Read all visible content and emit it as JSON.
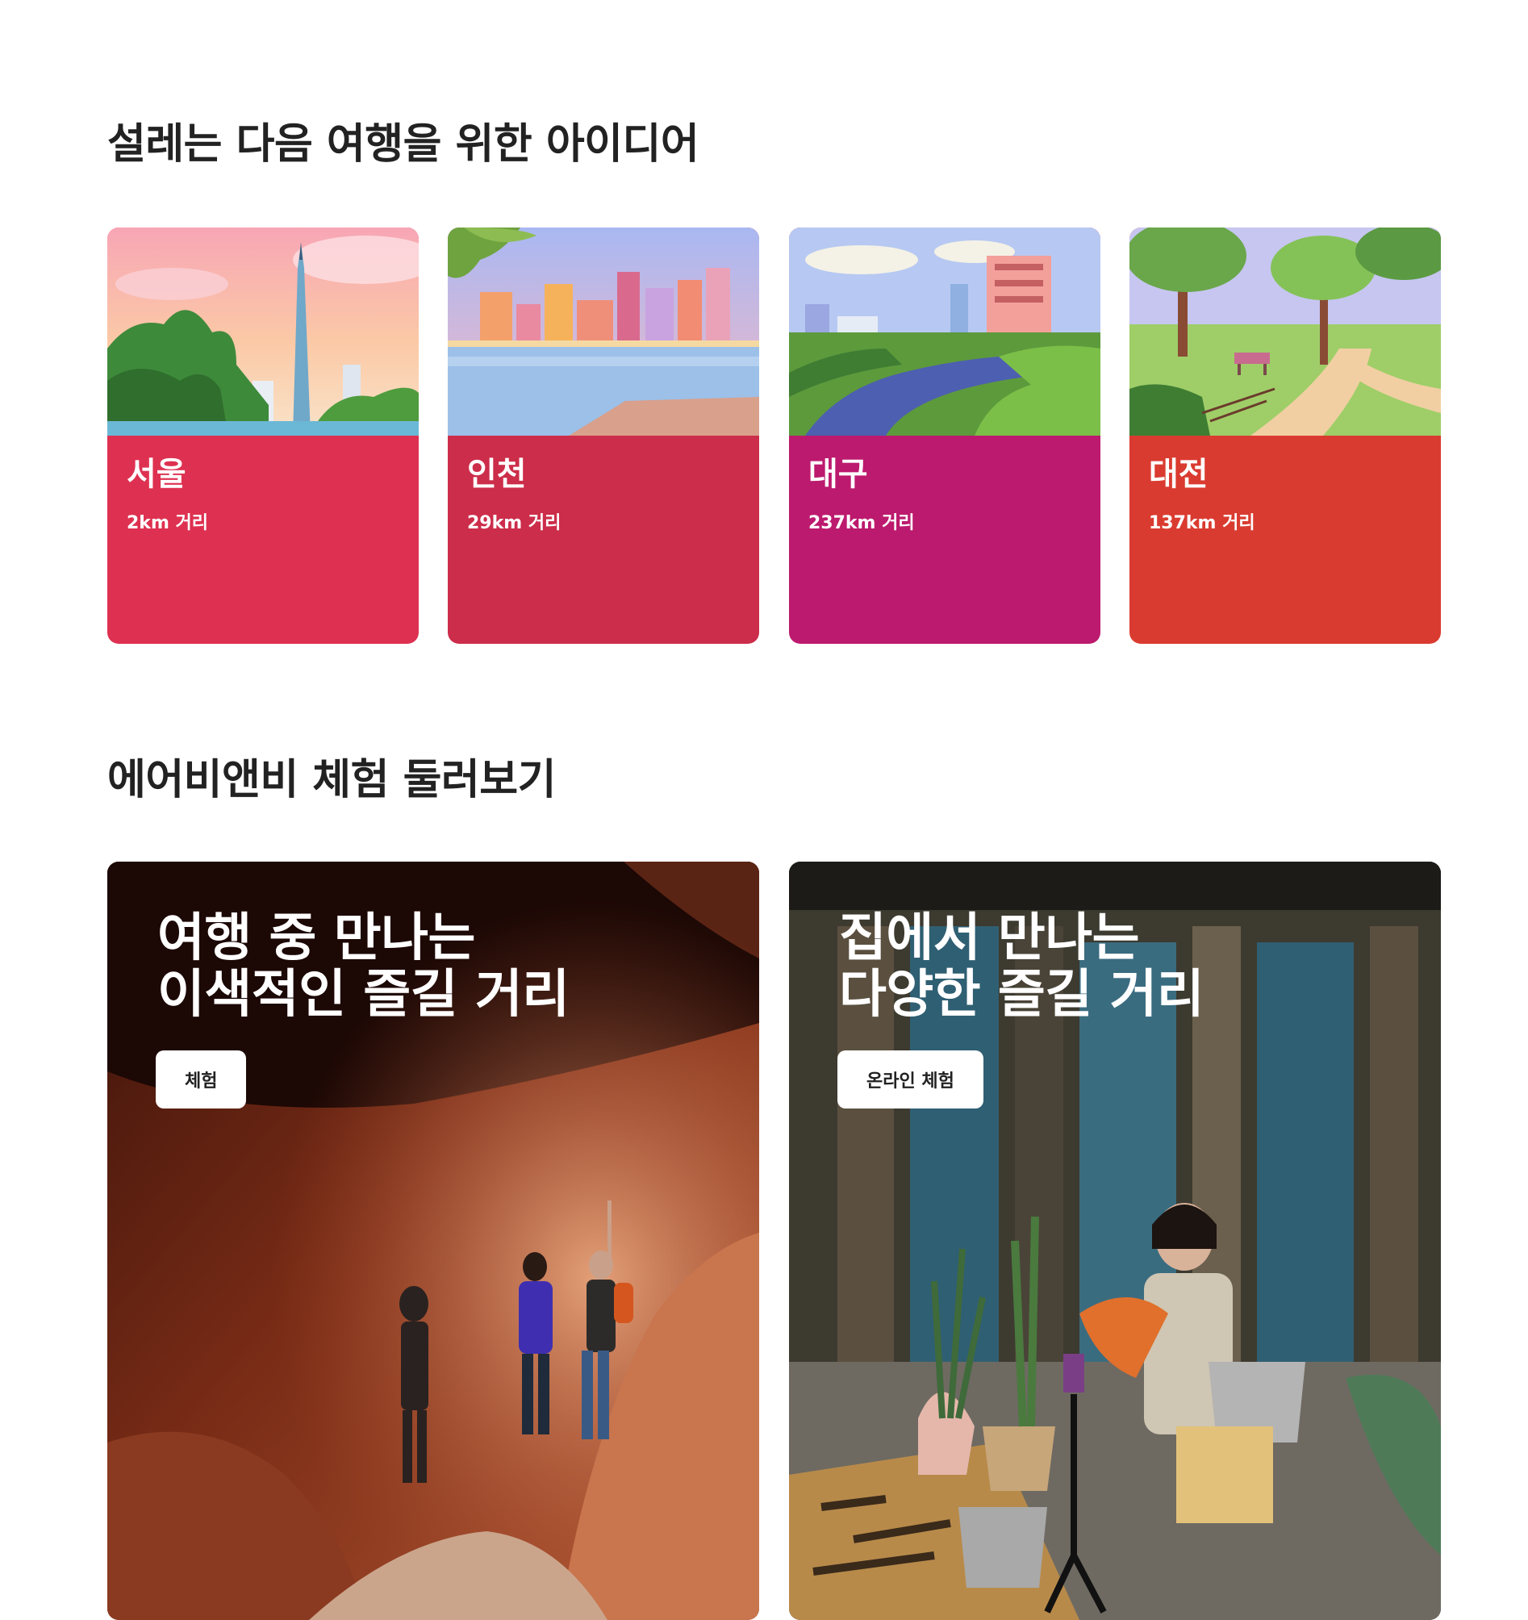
{
  "ideas": {
    "title": "설레는 다음 여행을 위한 아이디어",
    "cards": [
      {
        "city": "서울",
        "distance": "2km 거리",
        "color": "#DE3151",
        "illustration": "seoul-tower-illustration"
      },
      {
        "city": "인천",
        "distance": "29km 거리",
        "color": "#CC2D4A",
        "illustration": "incheon-waterfront-illustration"
      },
      {
        "city": "대구",
        "distance": "237km 거리",
        "color": "#BC1A6E",
        "illustration": "daegu-river-illustration"
      },
      {
        "city": "대전",
        "distance": "137km 거리",
        "color": "#DA3B30",
        "illustration": "daejeon-park-illustration"
      }
    ]
  },
  "experiences": {
    "title": "에어비앤비 체험 둘러보기",
    "cards": [
      {
        "headline": "여행 중 만나는\n이색적인 즐길 거리",
        "button": "체험",
        "image": "canyon-hikers-photo"
      },
      {
        "headline": "집에서 만나는\n다양한 즐길 거리",
        "button": "온라인 체험",
        "image": "dyeing-class-photo"
      }
    ]
  }
}
